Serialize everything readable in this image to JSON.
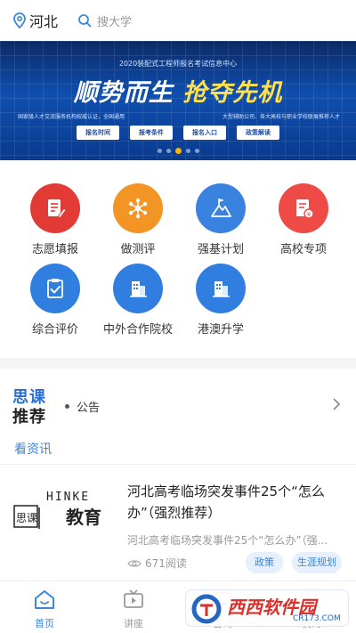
{
  "header": {
    "location": "河北",
    "search_placeholder": "搜大学",
    "location_icon": "location-pin-icon",
    "search_icon": "search-icon"
  },
  "banner": {
    "top_text": "2020装配式工程师报名考试信息中心",
    "headline_part1": "顺势而生",
    "headline_part2": "抢夺先机",
    "sub_left": "国家级人才交流服务机构权威认证，全国通用",
    "sub_right": "大型辅助公司、各大高校与职业学校联展推荐人才",
    "buttons": [
      "报名时间",
      "报考条件",
      "报名入口",
      "政策解读"
    ],
    "active_slide": 3,
    "slide_count": 5
  },
  "grid": {
    "items": [
      {
        "label": "志愿填报",
        "icon": "form-pen-icon",
        "color": "#e23b35"
      },
      {
        "label": "做测评",
        "icon": "network-nodes-icon",
        "color": "#f39524"
      },
      {
        "label": "强基计划",
        "icon": "mountain-flag-icon",
        "color": "#3a82e0"
      },
      {
        "label": "高校专项",
        "icon": "document-badge-icon",
        "color": "#ee4b46"
      },
      {
        "label": "综合评价",
        "icon": "clipboard-check-icon",
        "color": "#2f7ee0"
      },
      {
        "label": "中外合作院校",
        "icon": "building-icon",
        "color": "#2f7ee0"
      },
      {
        "label": "港澳升学",
        "icon": "building-icon",
        "color": "#2f7ee0"
      }
    ]
  },
  "notice": {
    "logo_top": "思课",
    "logo_bottom": "推荐",
    "text": "公告",
    "chevron_icon": "chevron-right-icon"
  },
  "tab": {
    "label": "看资讯"
  },
  "article": {
    "thumb_text": "HINKE",
    "thumb_text2": "思课",
    "thumb_text3": "教育",
    "title": "河北高考临场突发事件25个“怎么办”（强烈推荐）",
    "summary": "河北高考临场突发事件25个“怎么办”（强...",
    "views": "671阅读",
    "tags": [
      "政策",
      "生涯规划"
    ]
  },
  "bottom_nav": {
    "items": [
      {
        "label": "首页",
        "icon": "home-icon",
        "active": true
      },
      {
        "label": "讲座",
        "icon": "tv-play-icon",
        "active": false
      },
      {
        "label": "咨询",
        "icon": "chat-icon",
        "active": false
      },
      {
        "label": "我的",
        "icon": "user-icon",
        "active": false
      }
    ]
  },
  "watermark": {
    "text": "西西软件园",
    "url": "CR173.COM"
  }
}
